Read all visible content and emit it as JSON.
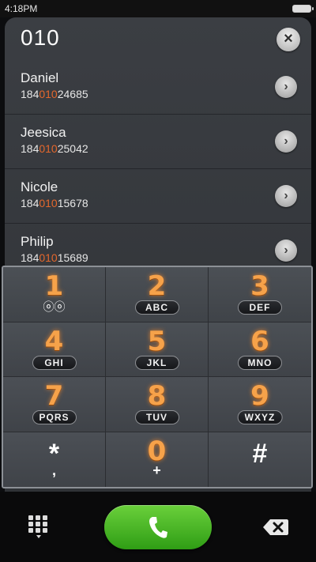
{
  "status": {
    "time": "4:18PM"
  },
  "search": {
    "query": "010",
    "clear_icon": "×"
  },
  "contacts": [
    {
      "name": "Daniel",
      "num_prefix": "184",
      "num_match": "010",
      "num_suffix": "24685"
    },
    {
      "name": "Jeesica",
      "num_prefix": "184",
      "num_match": "010",
      "num_suffix": "25042"
    },
    {
      "name": "Nicole",
      "num_prefix": "184",
      "num_match": "010",
      "num_suffix": "15678"
    },
    {
      "name": "Philip",
      "num_prefix": "184",
      "num_match": "010",
      "num_suffix": "15689"
    }
  ],
  "keypad": {
    "k1": {
      "digit": "1",
      "sub": "ⓞⓞ"
    },
    "k2": {
      "digit": "2",
      "letters": "ABC"
    },
    "k3": {
      "digit": "3",
      "letters": "DEF"
    },
    "k4": {
      "digit": "4",
      "letters": "GHI"
    },
    "k5": {
      "digit": "5",
      "letters": "JKL"
    },
    "k6": {
      "digit": "6",
      "letters": "MNO"
    },
    "k7": {
      "digit": "7",
      "letters": "PQRS"
    },
    "k8": {
      "digit": "8",
      "letters": "TUV"
    },
    "k9": {
      "digit": "9",
      "letters": "WXYZ"
    },
    "kstar": {
      "symbol": "*",
      "sub": ","
    },
    "k0": {
      "digit": "0",
      "sub": "+"
    },
    "khash": {
      "symbol": "#"
    }
  },
  "colors": {
    "accent": "#e4672c",
    "call_green": "#3fb01f",
    "digit_orange": "#f6a24a"
  },
  "icons": {
    "clear": "close-icon",
    "detail": "chevron-right-icon",
    "keypad": "keypad-grid-icon",
    "call": "phone-icon",
    "backspace": "backspace-icon"
  }
}
